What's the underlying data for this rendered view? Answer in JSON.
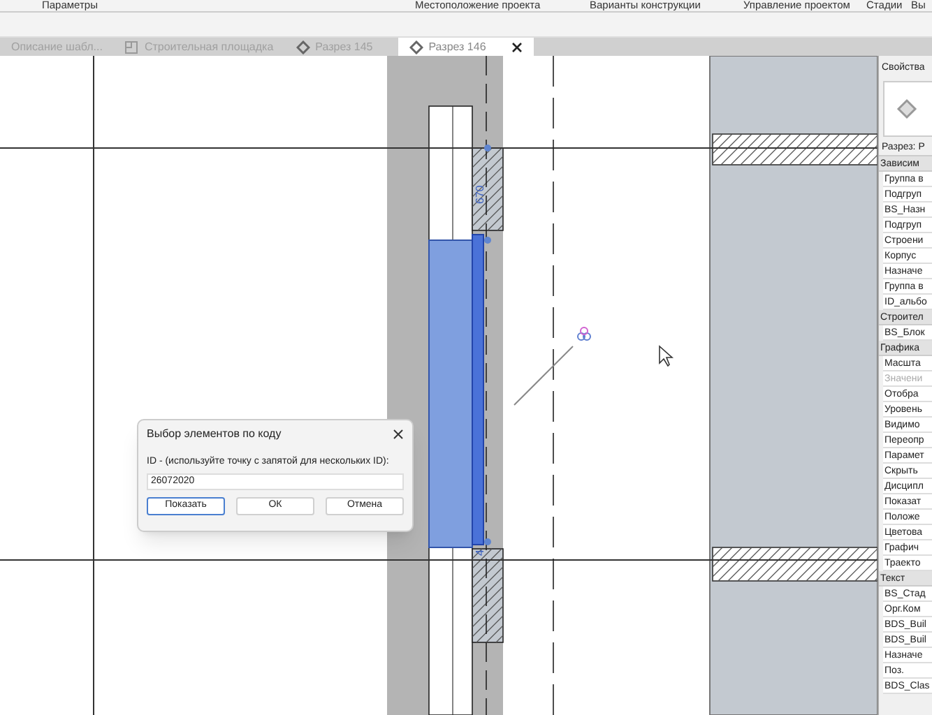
{
  "ribbon": {
    "groups": [
      "Параметры",
      "Местоположение проекта",
      "Варианты конструкции",
      "Управление проектом",
      "Стадии",
      "Вы"
    ]
  },
  "tabs": [
    {
      "label": "Описание шабл...",
      "selected": false,
      "kind": "text"
    },
    {
      "label": "Строительная площадка",
      "selected": false,
      "kind": "plan"
    },
    {
      "label": "Разрез 145",
      "selected": false,
      "kind": "section"
    },
    {
      "label": "Разрез 146",
      "selected": true,
      "kind": "section"
    }
  ],
  "drawing": {
    "dimension": "670",
    "dimension_2": "4"
  },
  "dialog": {
    "title": "Выбор элементов по коду",
    "label": "ID - (используйте точку с запятой для нескольких ID):",
    "value": "26072020",
    "buttons": [
      {
        "label": "Показать",
        "selected": true
      },
      {
        "label": "ОК",
        "selected": false
      },
      {
        "label": "Отмена",
        "selected": false
      }
    ]
  },
  "properties": {
    "title": "Свойства",
    "type": "Разрез: Р",
    "rows": [
      {
        "kind": "group",
        "label": "Зависим"
      },
      {
        "kind": "param",
        "label": "Группа в",
        "disabled": false
      },
      {
        "kind": "param",
        "label": "Подгруп",
        "disabled": false
      },
      {
        "kind": "param",
        "label": "BS_Назн",
        "disabled": false
      },
      {
        "kind": "param",
        "label": "Подгруп",
        "disabled": false
      },
      {
        "kind": "param",
        "label": "Строени",
        "disabled": false
      },
      {
        "kind": "param",
        "label": "Корпус",
        "disabled": false
      },
      {
        "kind": "param",
        "label": "Назначе",
        "disabled": false
      },
      {
        "kind": "param",
        "label": "Группа в",
        "disabled": false
      },
      {
        "kind": "param",
        "label": "ID_альбо",
        "disabled": false
      },
      {
        "kind": "group",
        "label": "Строител"
      },
      {
        "kind": "param",
        "label": "BS_Блок",
        "disabled": false
      },
      {
        "kind": "group",
        "label": "Графика"
      },
      {
        "kind": "param",
        "label": "Масшта",
        "disabled": false
      },
      {
        "kind": "param",
        "label": "Значени",
        "disabled": true
      },
      {
        "kind": "param",
        "label": "Отобра",
        "disabled": false
      },
      {
        "kind": "param",
        "label": "Уровень",
        "disabled": false
      },
      {
        "kind": "param",
        "label": "Видимо",
        "disabled": false
      },
      {
        "kind": "param",
        "label": "Переопр",
        "disabled": false
      },
      {
        "kind": "param",
        "label": "Парамет",
        "disabled": false
      },
      {
        "kind": "param",
        "label": "Скрыть",
        "disabled": false
      },
      {
        "kind": "param",
        "label": "Дисципл",
        "disabled": false
      },
      {
        "kind": "param",
        "label": "Показат",
        "disabled": false
      },
      {
        "kind": "param",
        "label": "Положе",
        "disabled": false
      },
      {
        "kind": "param",
        "label": "Цветова",
        "disabled": false
      },
      {
        "kind": "param",
        "label": "Графич",
        "disabled": false
      },
      {
        "kind": "param",
        "label": "Траекто",
        "disabled": false
      },
      {
        "kind": "group",
        "label": "Текст"
      },
      {
        "kind": "param",
        "label": "BS_Стад",
        "disabled": false
      },
      {
        "kind": "param",
        "label": "Орг.Ком",
        "disabled": false
      },
      {
        "kind": "param",
        "label": "BDS_Buil",
        "disabled": false
      },
      {
        "kind": "param",
        "label": "BDS_Buil",
        "disabled": false
      },
      {
        "kind": "param",
        "label": "Назначе",
        "disabled": false
      },
      {
        "kind": "param",
        "label": "Поз.",
        "disabled": false
      },
      {
        "kind": "param",
        "label": "BDS_Clas",
        "disabled": false
      }
    ]
  }
}
